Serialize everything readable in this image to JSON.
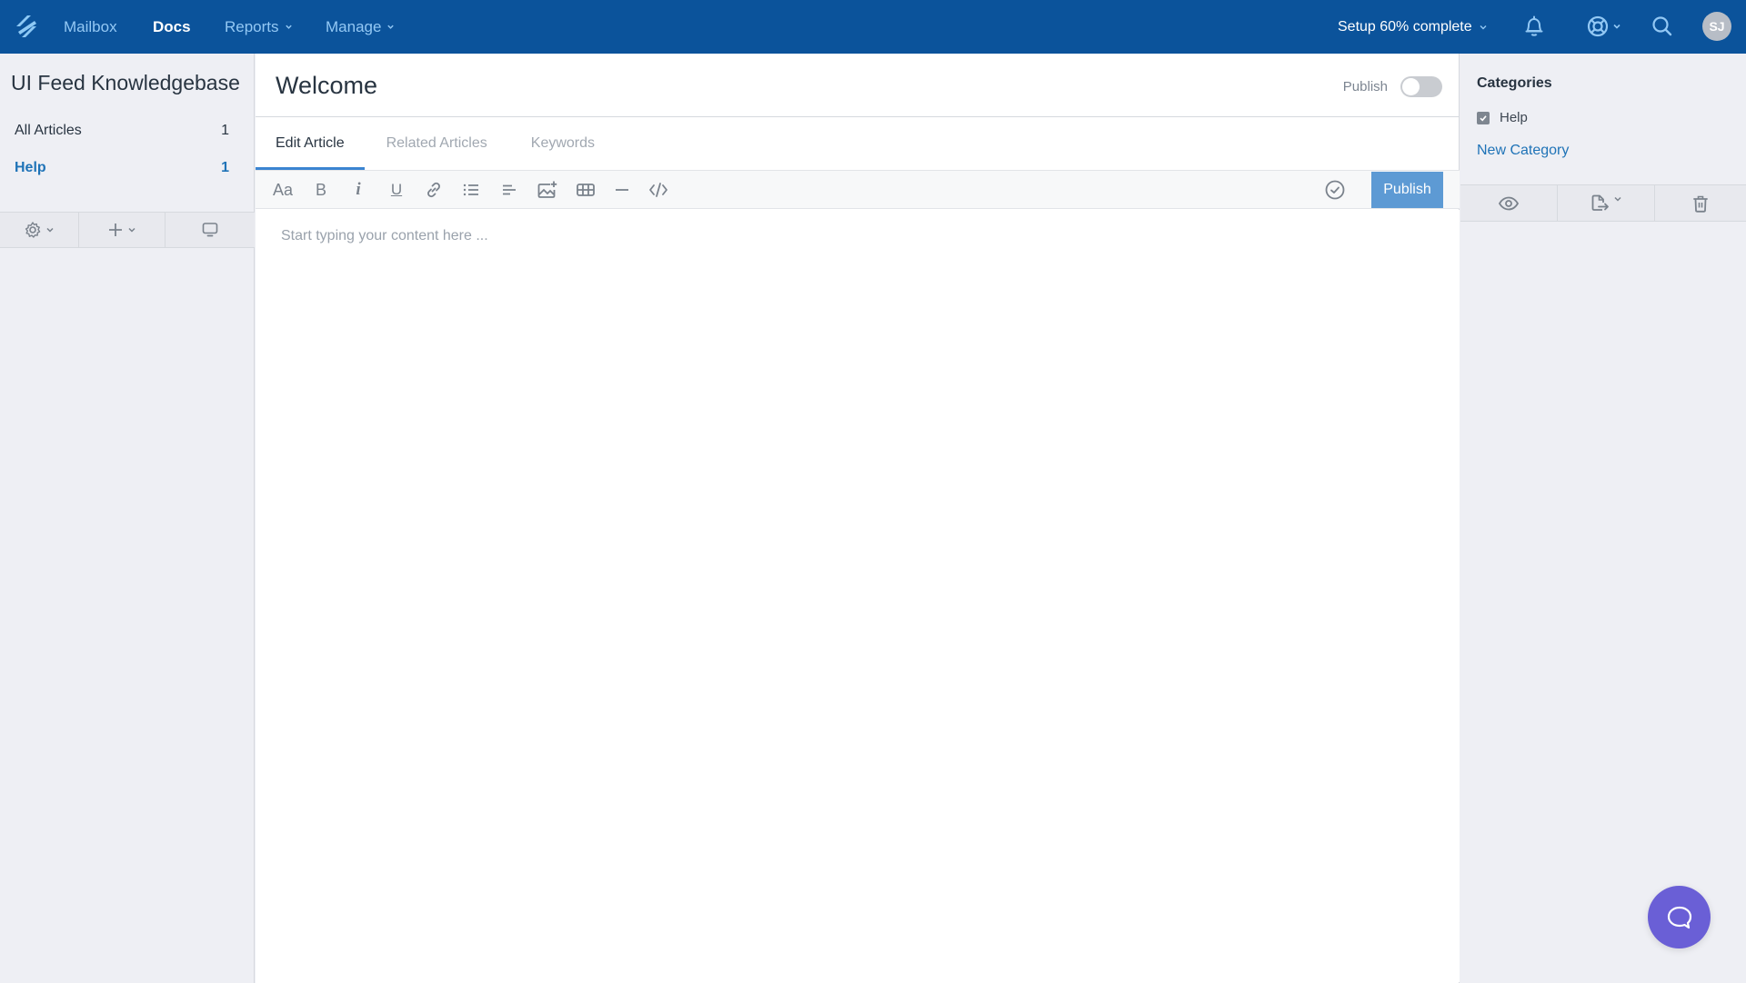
{
  "topnav": {
    "logo": "helpscout-logo",
    "items": [
      {
        "label": "Mailbox",
        "active": false,
        "dropdown": false
      },
      {
        "label": "Docs",
        "active": true,
        "dropdown": false
      },
      {
        "label": "Reports",
        "active": false,
        "dropdown": true
      },
      {
        "label": "Manage",
        "active": false,
        "dropdown": true
      }
    ],
    "setup_label": "Setup 60% complete",
    "setup_progress_percent": 60,
    "icons": [
      "bell-icon",
      "lifebuoy-icon",
      "search-icon"
    ],
    "avatar_initials": "SJ"
  },
  "sidebar": {
    "title": "UI Feed Knowledgebase",
    "items": [
      {
        "label": "All Articles",
        "count": "1",
        "active": false
      },
      {
        "label": "Help",
        "count": "1",
        "active": true
      }
    ],
    "toolbar": [
      "gear-icon",
      "plus-icon",
      "monitor-icon"
    ]
  },
  "article": {
    "title": "Welcome",
    "publish_toggle_label": "Publish",
    "publish_toggle_on": false,
    "tabs": [
      {
        "label": "Edit Article",
        "active": true
      },
      {
        "label": "Related Articles",
        "active": false
      },
      {
        "label": "Keywords",
        "active": false
      }
    ],
    "toolbar": [
      "font-size-icon",
      "bold-icon",
      "italic-icon",
      "underline-icon",
      "link-icon",
      "bullet-list-icon",
      "align-icon",
      "insert-image-icon",
      "table-icon",
      "horizontal-rule-icon",
      "code-icon"
    ],
    "publish_button": "Publish",
    "editor_placeholder": "Start typing your content here ...",
    "editor_value": ""
  },
  "right_panel": {
    "categories_title": "Categories",
    "categories": [
      {
        "label": "Help",
        "checked": true
      }
    ],
    "new_category_label": "New Category",
    "toolbar": [
      "eye-icon",
      "export-icon",
      "trash-icon"
    ]
  },
  "colors": {
    "nav_bg": "#0b539b",
    "accent": "#1f73b7",
    "publish_button": "#5d9ad4",
    "chat_button": "#6a5fd6"
  }
}
